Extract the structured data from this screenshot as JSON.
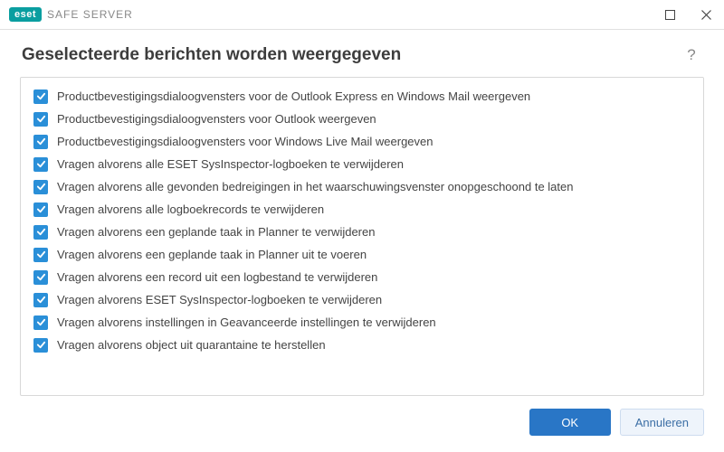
{
  "brand": {
    "badge": "eset",
    "product": "SAFE SERVER"
  },
  "header": {
    "title": "Geselecteerde berichten worden weergegeven"
  },
  "items": [
    {
      "checked": true,
      "label": "Productbevestigingsdialoogvensters voor de Outlook Express en Windows Mail weergeven"
    },
    {
      "checked": true,
      "label": "Productbevestigingsdialoogvensters voor Outlook weergeven"
    },
    {
      "checked": true,
      "label": "Productbevestigingsdialoogvensters voor Windows Live Mail weergeven"
    },
    {
      "checked": true,
      "label": "Vragen alvorens alle ESET SysInspector-logboeken te verwijderen"
    },
    {
      "checked": true,
      "label": "Vragen alvorens alle gevonden bedreigingen in het waarschuwingsvenster onopgeschoond te laten"
    },
    {
      "checked": true,
      "label": "Vragen alvorens alle logboekrecords te verwijderen"
    },
    {
      "checked": true,
      "label": "Vragen alvorens een geplande taak in Planner te verwijderen"
    },
    {
      "checked": true,
      "label": "Vragen alvorens een geplande taak in Planner uit te voeren"
    },
    {
      "checked": true,
      "label": "Vragen alvorens een record uit een logbestand te verwijderen"
    },
    {
      "checked": true,
      "label": "Vragen alvorens ESET SysInspector-logboeken te verwijderen"
    },
    {
      "checked": true,
      "label": "Vragen alvorens instellingen in Geavanceerde instellingen te verwijderen"
    },
    {
      "checked": true,
      "label": "Vragen alvorens object uit quarantaine te herstellen"
    }
  ],
  "footer": {
    "ok": "OK",
    "cancel": "Annuleren"
  }
}
